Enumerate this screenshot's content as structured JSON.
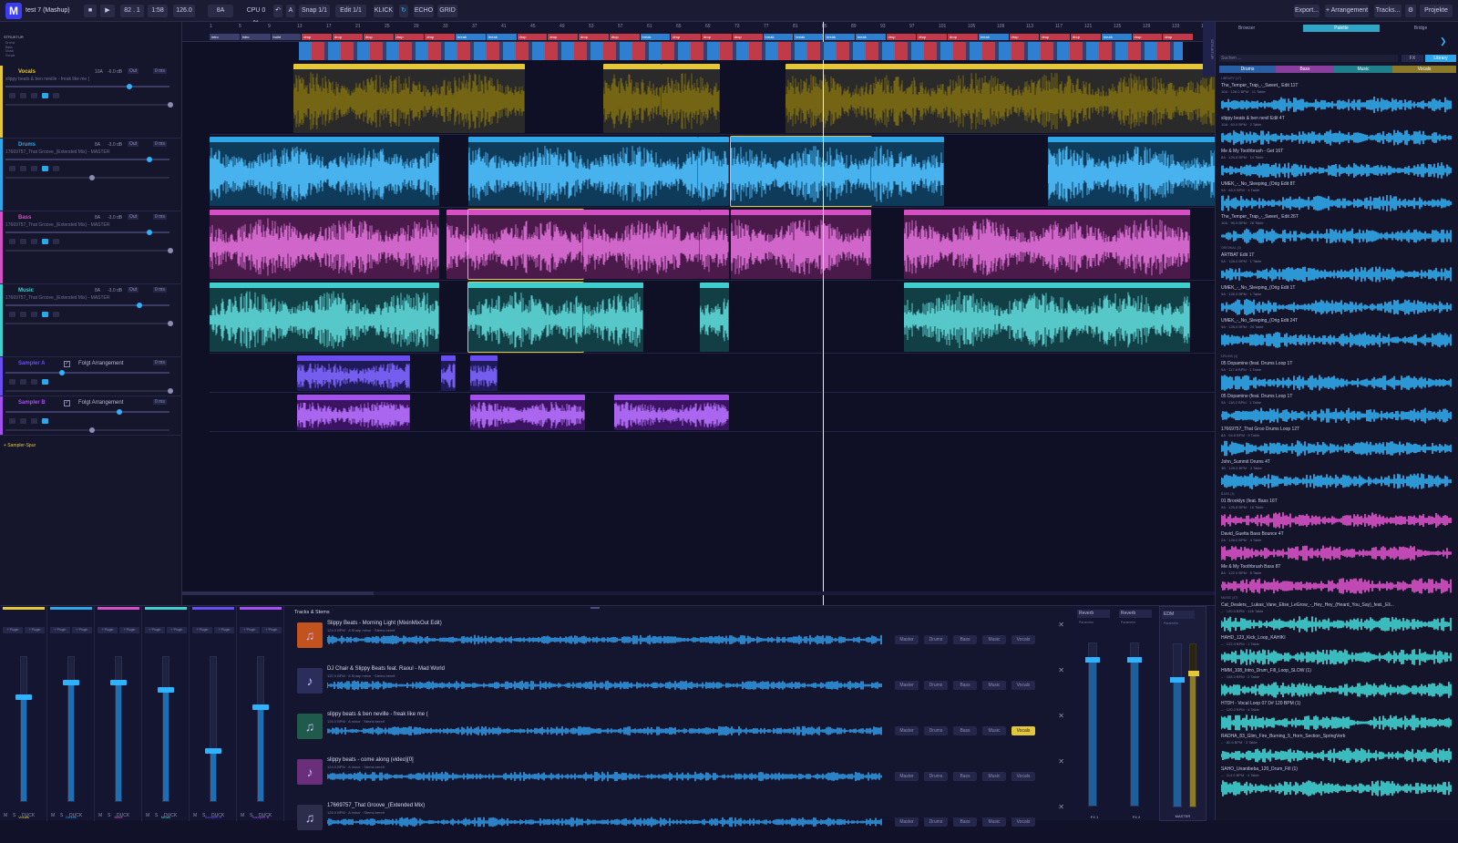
{
  "topbar": {
    "logo": "M",
    "project": "test 7 (Mashup)",
    "position": "82 . 1",
    "time": "1:58",
    "bpm": "126.0",
    "key": "8A",
    "cpu": "CPU 0 %",
    "snap": "Snap 1/1",
    "edit": "Edit 1/1",
    "klick": "KLICK",
    "echo": "ECHO",
    "grid": "GRID",
    "export": "Export...",
    "arranger": "+ Arrangement",
    "tracks": "Tracks...",
    "projects": "Projekte"
  },
  "structure": {
    "title": "STRUKTUR",
    "items": [
      "Drums",
      "Bass",
      "Music",
      "Vocals"
    ]
  },
  "tracks": [
    {
      "name": "Vocals",
      "sub": "slippy beats & ben neville - freak like me (",
      "color": "#e4c63a",
      "key": "10A",
      "db": "-6.0 dB",
      "mode": "Out",
      "delay": "0 ms"
    },
    {
      "name": "Drums",
      "sub": "17669757_That Groove_(Extended Mix) - MASTER",
      "color": "#2ea6e8",
      "key": "8A",
      "db": "-3.0 dB",
      "mode": "Out",
      "delay": "0 ms"
    },
    {
      "name": "Bass",
      "sub": "17669757_That Groove_(Extended Mix) - MASTER",
      "color": "#d44fc4",
      "key": "8A",
      "db": "-3.0 dB",
      "mode": "Out",
      "delay": "0 ms"
    },
    {
      "name": "Music",
      "sub": "17669757_That Groove_(Extended Mix) - MASTER",
      "color": "#3fcfcf",
      "key": "8A",
      "db": "-3.0 dB",
      "mode": "Out",
      "delay": "0 ms"
    },
    {
      "name": "Sampler A",
      "sub": "Folgt Arrangement",
      "color": "#6a4df0",
      "delay": "0 ms"
    },
    {
      "name": "Sampler B",
      "sub": "Folgt Arrangement",
      "color": "#a44ff0",
      "delay": "0 ms"
    }
  ],
  "add_sampler": "+ Sampler-Spur",
  "ruler": {
    "numbers": [
      "1",
      "5",
      "9",
      "13",
      "17",
      "21",
      "25",
      "29",
      "33",
      "37",
      "41",
      "45",
      "49",
      "53",
      "57",
      "61",
      "65",
      "69",
      "73",
      "77",
      "81",
      "85",
      "89",
      "93",
      "97",
      "101",
      "105",
      "109",
      "113",
      "117",
      "121",
      "125",
      "129",
      "133",
      "137",
      "141"
    ],
    "arrangement": [
      {
        "label": "intro",
        "color": "#3b3f6a"
      },
      {
        "label": "intro",
        "color": "#3b3f6a"
      },
      {
        "label": "build",
        "color": "#3b3f6a"
      },
      {
        "label": "drop",
        "color": "#c23a4a"
      },
      {
        "label": "drop",
        "color": "#c23a4a"
      },
      {
        "label": "drop",
        "color": "#c23a4a"
      },
      {
        "label": "drop",
        "color": "#c23a4a"
      },
      {
        "label": "drop",
        "color": "#c23a4a"
      },
      {
        "label": "break",
        "color": "#2f7fd0"
      },
      {
        "label": "break",
        "color": "#2f7fd0"
      },
      {
        "label": "drop",
        "color": "#c23a4a"
      },
      {
        "label": "drop",
        "color": "#c23a4a"
      },
      {
        "label": "drop",
        "color": "#c23a4a"
      },
      {
        "label": "drop",
        "color": "#c23a4a"
      },
      {
        "label": "break",
        "color": "#2f7fd0"
      },
      {
        "label": "drop",
        "color": "#c23a4a"
      },
      {
        "label": "drop",
        "color": "#c23a4a"
      },
      {
        "label": "drop",
        "color": "#c23a4a"
      },
      {
        "label": "break",
        "color": "#2f7fd0"
      },
      {
        "label": "break",
        "color": "#2f7fd0"
      },
      {
        "label": "break",
        "color": "#2f7fd0"
      },
      {
        "label": "break",
        "color": "#2f7fd0"
      },
      {
        "label": "drop",
        "color": "#c23a4a"
      },
      {
        "label": "drop",
        "color": "#c23a4a"
      },
      {
        "label": "drop",
        "color": "#c23a4a"
      },
      {
        "label": "break",
        "color": "#2f7fd0"
      },
      {
        "label": "drop",
        "color": "#c23a4a"
      },
      {
        "label": "drop",
        "color": "#c23a4a"
      },
      {
        "label": "drop",
        "color": "#c23a4a"
      },
      {
        "label": "break",
        "color": "#2f7fd0"
      },
      {
        "label": "drop",
        "color": "#c23a4a"
      },
      {
        "label": "drop",
        "color": "#c23a4a"
      }
    ]
  },
  "clips": {
    "vocals": [
      "slippy beats & ben neville - freak like me ( — Vocals",
      "slippy beats & ben neville - freak like me ( — Vocals",
      "slippy beats & ben ... - Vocals",
      "slippy beats & ben neville - freak like me ( — Vocals"
    ],
    "drums": "17669757_That Groove_(Extended Mix) — Drums",
    "bass": "17669757_That Groove_(Extended Mix) — Bass",
    "music": "17669757_That Groove_(Extended Mix) — Music"
  },
  "right": {
    "tabs": [
      "Browser",
      "Palette",
      "Bridge"
    ],
    "search_placeholder": "Suchen ...",
    "fx": "FX",
    "library": "Library",
    "cat_tabs": [
      "Drums",
      "Bass",
      "Music",
      "Vocals"
    ],
    "sections": [
      "LIBRARY (17)",
      "ORIGINAL (3)",
      "DRUMS (4)",
      "BASS (3)",
      "MUSIC (47)"
    ],
    "items": [
      {
        "name": "The_Temper_Trap_-_Sweet_ Edit 11T",
        "sub": "10A · 128.0 BPM · 11 Takte",
        "color": "#2ea6e8"
      },
      {
        "name": "slippy beats & ben nevil Edit 4T",
        "sub": "10A · 63.0 BPM · 2 Takte",
        "color": "#2ea6e8"
      },
      {
        "name": "Me & My Toothbrush - Get 16T",
        "sub": "8A · 126.8 BPM · 14 Takte",
        "color": "#2ea6e8"
      },
      {
        "name": "UMEK_-_No_Sleeping_(Orig Edit 8T",
        "sub": "9A · 68.0 BPM · 4 Takte",
        "color": "#2ea6e8"
      },
      {
        "name": "The_Temper_Trap_-_Sweet_ Edit 26T",
        "sub": "10A · 96.5 BPM · 26 Takte",
        "color": "#2ea6e8"
      },
      {
        "name": "ARTBAT Edit 1T",
        "sub": "5A · 128.0 BPM · 1 Takte",
        "color": "#2ea6e8"
      },
      {
        "name": "UMEK_-_No_Sleeping_(Orig Edit 1T",
        "sub": "9A · 128.0 BPM · 1 Takte",
        "color": "#2ea6e8"
      },
      {
        "name": "UMEK_-_No_Sleeping_(Orig Edit 24T",
        "sub": "9A · 128.0 BPM · 24 Takte",
        "color": "#2ea6e8"
      },
      {
        "name": "05 Dopamine (feat. Drums Loop 1T",
        "sub": "9A · 117.8 BPM · 1 Takte",
        "color": "#2ea6e8"
      },
      {
        "name": "05 Dopamine (feat. Drums Loop 1T",
        "sub": "9A · 118.2 BPM · 1 Takte",
        "color": "#2ea6e8"
      },
      {
        "name": "17669757_That Groo Drums Loop 12T",
        "sub": "8A · 94.8 BPM · 9 Takte",
        "color": "#2ea6e8"
      },
      {
        "name": "John_Summit Drums 4T",
        "sub": "3B · 126.8 BPM · 4 Takte",
        "color": "#2ea6e8"
      },
      {
        "name": "01 Brooklyn (feat. Bass 16T",
        "sub": "9A · 125.8 BPM · 16 Takte",
        "color": "#d44fc4"
      },
      {
        "name": "David_Guetta Bass Bounce 4T",
        "sub": "2A · 128.0 BPM · 4 Takte",
        "color": "#d44fc4"
      },
      {
        "name": "Me & My Toothbrush Bass 8T",
        "sub": "8A · 122.0 BPM · 8 Takte",
        "color": "#d44fc4"
      },
      {
        "name": "Cat_Dealers__Lukas_Vane_Elise_LeGrow_-_Hey_Hey_(Heard_You_Say)_feat._Eli...",
        "sub": "– · 120.0 BPM · 146 Takte",
        "color": "#3fcfcf"
      },
      {
        "name": "HAHD_123_Kick_Loop_KAHIKI",
        "sub": "– · 122.0 BPM · 1 Takte",
        "color": "#3fcfcf"
      },
      {
        "name": "HMM_108_Intro_Drum_Fill_Loop_SLOW (1)",
        "sub": "– · 108.0 BPM · 2 Takte",
        "color": "#3fcfcf"
      },
      {
        "name": "HTDH - Vocal Loop 07 D# 120 BPM (1)",
        "sub": "– · 120.0 BPM · 4 Takte",
        "color": "#3fcfcf"
      },
      {
        "name": "RADHA_83_Glim_Fire_Burning_5_Horn_Section_SpringVerb",
        "sub": "– · 82.5 BPM · 3 Takte",
        "color": "#3fcfcf"
      },
      {
        "name": "SAHO_Unanibeba_120_Drum_Fill (1)",
        "sub": "– · 114.0 BPM · 4 Takte",
        "color": "#3fcfcf"
      }
    ]
  },
  "mixer": {
    "channels": [
      {
        "name": "Vocals",
        "color": "#e4c63a",
        "level": 0.72
      },
      {
        "name": "Drums",
        "color": "#2ea6e8",
        "level": 0.82
      },
      {
        "name": "Bass",
        "color": "#d44fc4",
        "level": 0.82
      },
      {
        "name": "Music",
        "color": "#3fcfcf",
        "level": 0.77
      },
      {
        "name": "Sampler A",
        "color": "#6a4df0",
        "level": 0.35
      },
      {
        "name": "Sampler B",
        "color": "#a44ff0",
        "level": 0.65
      }
    ],
    "btn_m": "M",
    "btn_s": "S",
    "btn_duck": "DUCK",
    "plugin": "+ Plugin"
  },
  "stems": {
    "header": "Tracks & Stems",
    "rows": [
      {
        "title": "Slippy Beats - Morning Light (MixinMixOut Edit)",
        "meta": "124.0 BPM · 8 Sharp minor · Stems bereit",
        "active": -1
      },
      {
        "title": "DJ Chair & Slippy Beats feat. Raoul - Mad World",
        "meta": "120.0 BPM · 8 Sharp minor · Stems bereit",
        "active": -1
      },
      {
        "title": "slippy beats & ben neville - freak like me (",
        "meta": "126.0 BPM · A minor · Stems bereit",
        "active": 4
      },
      {
        "title": "slippy beats - come along (video)[0]",
        "meta": "124.0 BPM · A minor · Stems bereit",
        "active": -1
      },
      {
        "title": "17669757_That Groove_(Extended Mix)",
        "meta": "126.0 BPM · A minor · Stems bereit",
        "active": -1
      }
    ],
    "buttons": [
      "Master",
      "Drums",
      "Bass",
      "Music",
      "Vocals"
    ]
  },
  "fx": {
    "slots": [
      "Reverb",
      "Reverb",
      "EDM"
    ],
    "labels": [
      "FX 1",
      "FX 2",
      "MASTER"
    ],
    "param": "Parameter"
  }
}
